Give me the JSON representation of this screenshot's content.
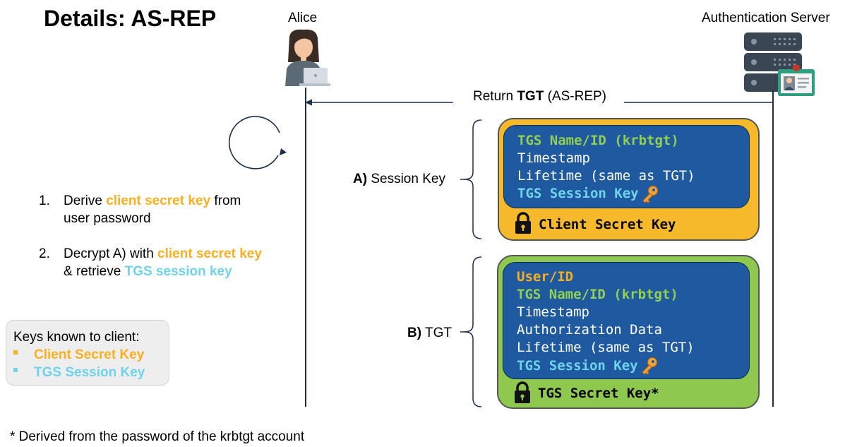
{
  "title": "Details: AS-REP",
  "actors": {
    "client": "Alice",
    "server": "Authentication Server"
  },
  "message": {
    "prefix": "Return ",
    "bold": "TGT",
    "suffix": " (AS-REP)"
  },
  "session_key": {
    "label_bold": "A)",
    "label_rest": " Session Key",
    "fields": {
      "f1": "TGS Name/ID (krbtgt)",
      "f2": "Timestamp",
      "f3": "Lifetime (same as TGT)",
      "f4": "TGS Session Key"
    },
    "encrypted_with": "Client Secret Key"
  },
  "tgt": {
    "label_bold": "B)",
    "label_rest": " TGT",
    "fields": {
      "f1": "User/ID",
      "f2": "TGS Name/ID (krbtgt)",
      "f3": "Timestamp",
      "f4": "Authorization Data",
      "f5": "Lifetime (same as TGT)",
      "f6": "TGS Session Key"
    },
    "encrypted_with": "TGS Secret Key*"
  },
  "steps": {
    "s1": {
      "num": "1.",
      "pre": "Derive ",
      "hl": "client secret key",
      "post": " from",
      "line2": "user password"
    },
    "s2": {
      "num": "2.",
      "pre": "Decrypt A) with ",
      "hl": "client secret key",
      "line2_pre": "& retrieve ",
      "line2_hl": "TGS session key"
    }
  },
  "keys_known": {
    "heading": "Keys known to client:",
    "k1": "Client Secret Key",
    "k2": "TGS Session Key"
  },
  "footnote": "* Derived from the password of the krbtgt account",
  "colors": {
    "orange": "#f6b021",
    "cyan": "#6fd3ec",
    "green": "#92d050",
    "navy": "#1f5aa0",
    "session_box": "#f6b92b",
    "tgt_box": "#8fc84f"
  },
  "icons": [
    "user-laptop-icon",
    "server-icon",
    "id-card-icon",
    "refresh-circle-icon",
    "key-icon",
    "lock-icon"
  ]
}
